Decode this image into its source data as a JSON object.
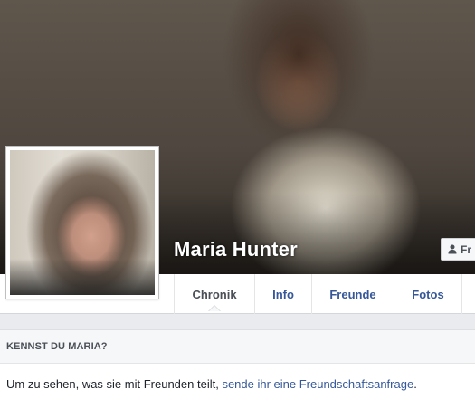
{
  "profile": {
    "name": "Maria Hunter",
    "friend_button_label": "Fr"
  },
  "tabs": [
    {
      "label": "Chronik",
      "active": true
    },
    {
      "label": "Info"
    },
    {
      "label": "Freunde"
    },
    {
      "label": "Fotos"
    }
  ],
  "know_box": {
    "heading": "KENNST DU MARIA?",
    "text": "Um zu sehen, was sie mit Freunden teilt, ",
    "link": "sende ihr eine Freundschaftsanfrage",
    "tail": "."
  },
  "colors": {
    "link": "#365899",
    "page_bg": "#e9ebee"
  },
  "icons": {
    "friend_button": "add-friend-icon"
  }
}
